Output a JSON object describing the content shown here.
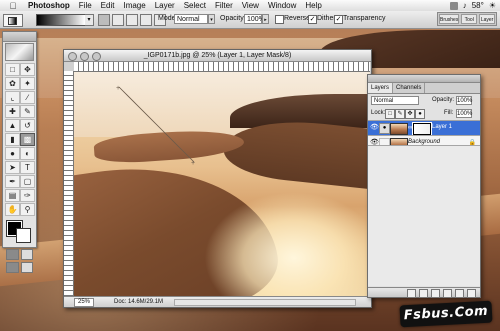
{
  "menubar": {
    "app_name": "Photoshop",
    "items": [
      "File",
      "Edit",
      "Image",
      "Layer",
      "Select",
      "Filter",
      "View",
      "Window",
      "Help"
    ],
    "temperature": "58°"
  },
  "options_bar": {
    "mode_label": "Mode:",
    "mode_value": "Normal",
    "opacity_label": "Opacity:",
    "opacity_value": "100%",
    "reverse_label": "Reverse",
    "reverse_checked": false,
    "dither_label": "Dither",
    "dither_checked": true,
    "transparency_label": "Transparency",
    "transparency_checked": true,
    "well_tabs": [
      "Brushes",
      "Tool",
      "Layer"
    ]
  },
  "document": {
    "title": "_IGP0171b.jpg @ 25% (Layer 1, Layer Mask/8)",
    "zoom": "25%",
    "doc_info": "Doc: 14.6M/29.1M"
  },
  "layers_palette": {
    "tabs": [
      "Layers",
      "Channels"
    ],
    "active_tab": "Layers",
    "blend_mode": "Normal",
    "opacity_label": "Opacity:",
    "opacity_value": "100%",
    "lock_label": "Lock:",
    "fill_label": "Fill:",
    "fill_value": "100%",
    "layers": [
      {
        "name": "Layer 1",
        "selected": true
      },
      {
        "name": "Background",
        "selected": false
      }
    ]
  },
  "watermark": "Fsbus.Com",
  "colors": {
    "selection": "#3a6fd6",
    "foreground": "#000000",
    "background": "#ffffff"
  }
}
